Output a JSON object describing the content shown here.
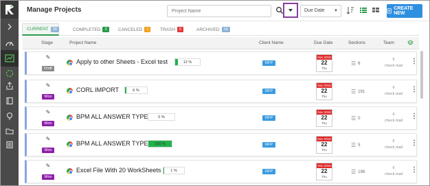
{
  "header": {
    "title": "Manage Projects",
    "search_placeholder": "Project Name",
    "sort_value": "Due Date",
    "create_label": "CREATE NEW"
  },
  "tabs": [
    {
      "label": "CURRENT",
      "count": "38",
      "color": "#8fb3d9"
    },
    {
      "label": "COMPLETED",
      "count": "3",
      "color": "#2a9a4a"
    },
    {
      "label": "CANCELED",
      "count": "1",
      "color": "#f0a020"
    },
    {
      "label": "TRASH",
      "count": "0",
      "color": "#e03a3a"
    },
    {
      "label": "ARCHIVED",
      "count": "16",
      "color": "#8fb3d9"
    }
  ],
  "columns": {
    "stage": "Stage",
    "project_name": "Project Name",
    "client_name": "Client Name",
    "due_date": "Due Date",
    "sections": "Sections",
    "team": "Team"
  },
  "colors": {
    "accent": "#2f8fe0",
    "rfp": "#3b9be0",
    "won": "#8e1ea8",
    "draft": "#8a8a8a",
    "progress": "#22b14c",
    "calendar": "#e02828"
  },
  "rows": [
    {
      "stage": "Draft",
      "stage_color": "#8a8a8a",
      "name": "Apply to other Sheets - Excel test",
      "progress": 12,
      "progress_label": "12 %",
      "client": "RFP",
      "month": "Nov 2018",
      "day": "22",
      "weekday": "Thu",
      "sections": "6",
      "team_count": "6",
      "team_label": "check mail"
    },
    {
      "stage": "Won",
      "stage_color": "#8e1ea8",
      "name": "CORL IMPORT",
      "progress": 6,
      "progress_label": "6 %",
      "client": "RFP",
      "month": "Nov 2018",
      "day": "22",
      "weekday": "Thu",
      "sections": "191",
      "team_count": "6",
      "team_label": "check mail"
    },
    {
      "stage": "Won",
      "stage_color": "#8e1ea8",
      "name": "BPM ALL ANSWER TYPE",
      "progress": 0,
      "progress_label": "0 %",
      "client": "RFP",
      "month": "Nov 2018",
      "day": "22",
      "weekday": "Thu",
      "sections": "0",
      "team_count": "6",
      "team_label": "check mail"
    },
    {
      "stage": "Won",
      "stage_color": "#8e1ea8",
      "name": "BPM ALL ANSWER TYPE",
      "progress": 100,
      "progress_label": "100 %",
      "client": "RFP",
      "month": "Nov 2018",
      "day": "22",
      "weekday": "Thu",
      "sections": "5",
      "team_count": "6",
      "team_label": "check mail"
    },
    {
      "stage": "Won",
      "stage_color": "#8e1ea8",
      "name": "Excel File With 20 WorkSheets",
      "progress": 1,
      "progress_label": "1 %",
      "client": "RFP",
      "month": "Nov 2018",
      "day": "22",
      "weekday": "Thu",
      "sections": "196",
      "team_count": "6",
      "team_label": "check mail"
    }
  ]
}
